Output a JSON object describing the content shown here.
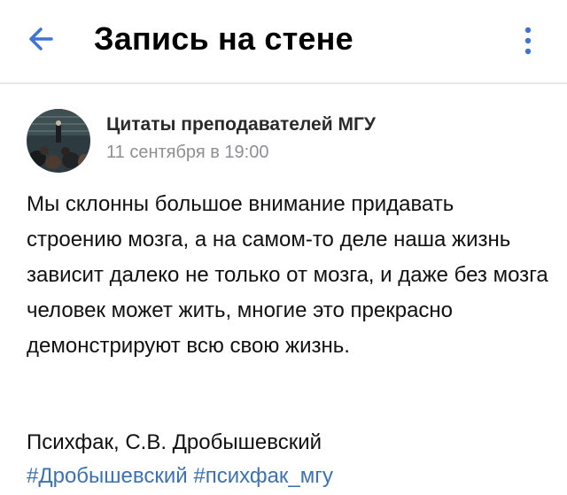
{
  "header": {
    "title": "Запись на стене",
    "back_icon": "arrow-left-icon",
    "more_icon": "vertical-dots-icon",
    "accent_color": "#3f74d4"
  },
  "post": {
    "author": "Цитаты преподавателей МГУ",
    "time": "11 сентября в 19:00",
    "text": "Мы склонны большое внимание придавать строению мозга, а на самом-то деле наша жизнь зависит далеко не только от мозга, и даже без мозга человек может жить, многие это прекрасно демонстрируют всю свою жизнь.",
    "signature": "Психфак, С.В. Дробышевский",
    "hashtags": [
      "#Дробышевский",
      "#психфак_мгу"
    ]
  }
}
